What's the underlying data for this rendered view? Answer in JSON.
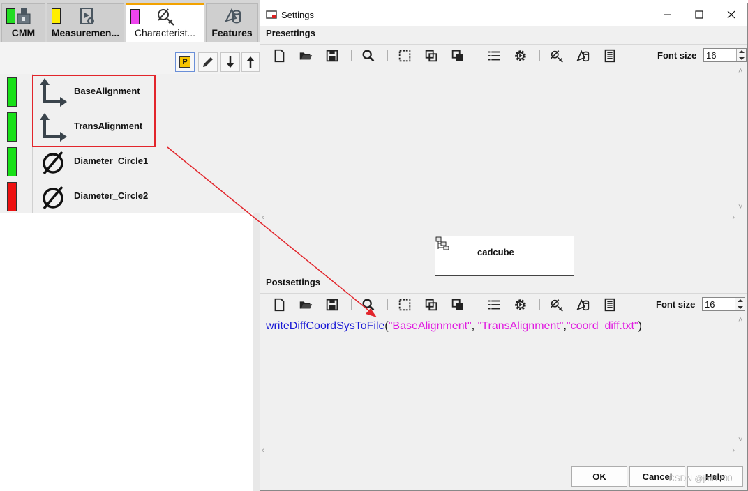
{
  "tabs": [
    {
      "label": "CMM",
      "swatch": "#22dd22",
      "icon": "cmm-machine-icon",
      "active": false
    },
    {
      "label": "Measuremen...",
      "swatch": "#ffee00",
      "icon": "measurement-plan-icon",
      "active": false
    },
    {
      "label": "Characterist...",
      "swatch": "#ee44ee",
      "icon": "characteristic-icon",
      "active": true
    },
    {
      "label": "Features",
      "swatch": "",
      "icon": "features-icon",
      "active": false
    }
  ],
  "left_toolbar": {
    "buttons": [
      "p-marker-icon",
      "pencil-icon",
      "arrow-down-icon",
      "arrow-up-icon"
    ],
    "p_label": "P"
  },
  "characteristics": [
    {
      "label": "BaseAlignment",
      "status": "#18e018",
      "icon": "alignment-icon"
    },
    {
      "label": "TransAlignment",
      "status": "#18e018",
      "icon": "alignment-icon"
    },
    {
      "label": "Diameter_Circle1",
      "status": "#18e018",
      "icon": "diameter-icon"
    },
    {
      "label": "Diameter_Circle2",
      "status": "#ee1111",
      "icon": "diameter-icon"
    }
  ],
  "dialog": {
    "title": "Settings",
    "presettings_label": "Presettings",
    "postsettings_label": "Postsettings",
    "font_size_label": "Font size",
    "pre_font_size": "16",
    "post_font_size": "16",
    "cad_label": "cadcube",
    "toolbar_icons": [
      "new-file-icon",
      "open-folder-icon",
      "save-icon",
      "search-icon",
      "select-frame-icon",
      "copy-icon",
      "paste-icon",
      "list-icon",
      "settings-gear-icon",
      "characteristic-icon",
      "feature-icon",
      "document-icon"
    ],
    "post_code": {
      "fn": "writeDiffCoordSysToFile",
      "open": "(",
      "arg1": "\"BaseAlignment\"",
      "sep1": ", ",
      "arg2": "\"TransAlignment\"",
      "sep2": ",",
      "arg3": "\"coord_diff.txt\"",
      "close": ")"
    },
    "ok_label": "OK",
    "cancel_label": "Cancel",
    "help_label": "Help"
  },
  "watermark": "CSDN @jml1200",
  "colors": {
    "annotation": "#e2252b",
    "function": "#1a1ad6",
    "string": "#e01ae0"
  }
}
